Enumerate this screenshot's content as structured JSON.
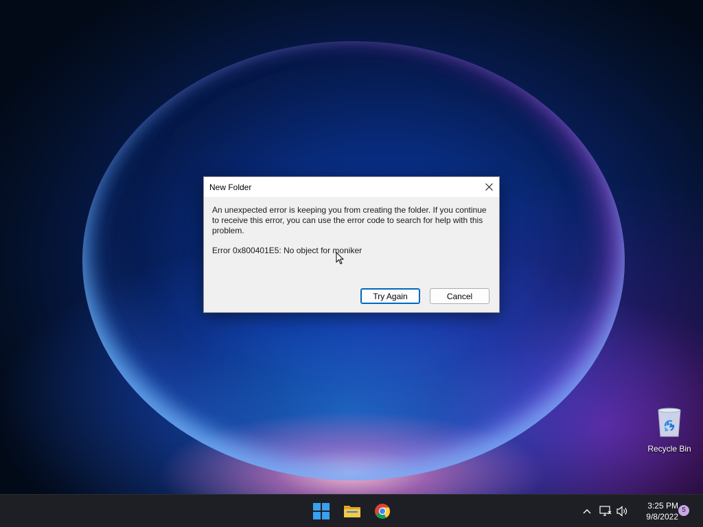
{
  "dialog": {
    "title": "New Folder",
    "message": "An unexpected error is keeping you from creating the folder. If you continue to receive this error, you can use the error code to search for help with this problem.",
    "error_code": "Error 0x800401E5: No object for moniker",
    "buttons": {
      "try_again": "Try Again",
      "cancel": "Cancel"
    },
    "default_button_color": "#0067c0"
  },
  "desktop": {
    "icons": [
      {
        "label": "Recycle Bin",
        "icon": "recycle-bin-icon"
      }
    ]
  },
  "taskbar": {
    "apps": [
      {
        "name": "start",
        "icon": "windows-start-icon"
      },
      {
        "name": "file-explorer",
        "icon": "folder-icon"
      },
      {
        "name": "chrome",
        "icon": "chrome-icon"
      }
    ],
    "tray": {
      "icons": [
        "chevron-up-icon",
        "network-icon",
        "volume-icon"
      ],
      "time": "3:25 PM",
      "date": "9/8/2022",
      "notification_count": "5"
    }
  }
}
